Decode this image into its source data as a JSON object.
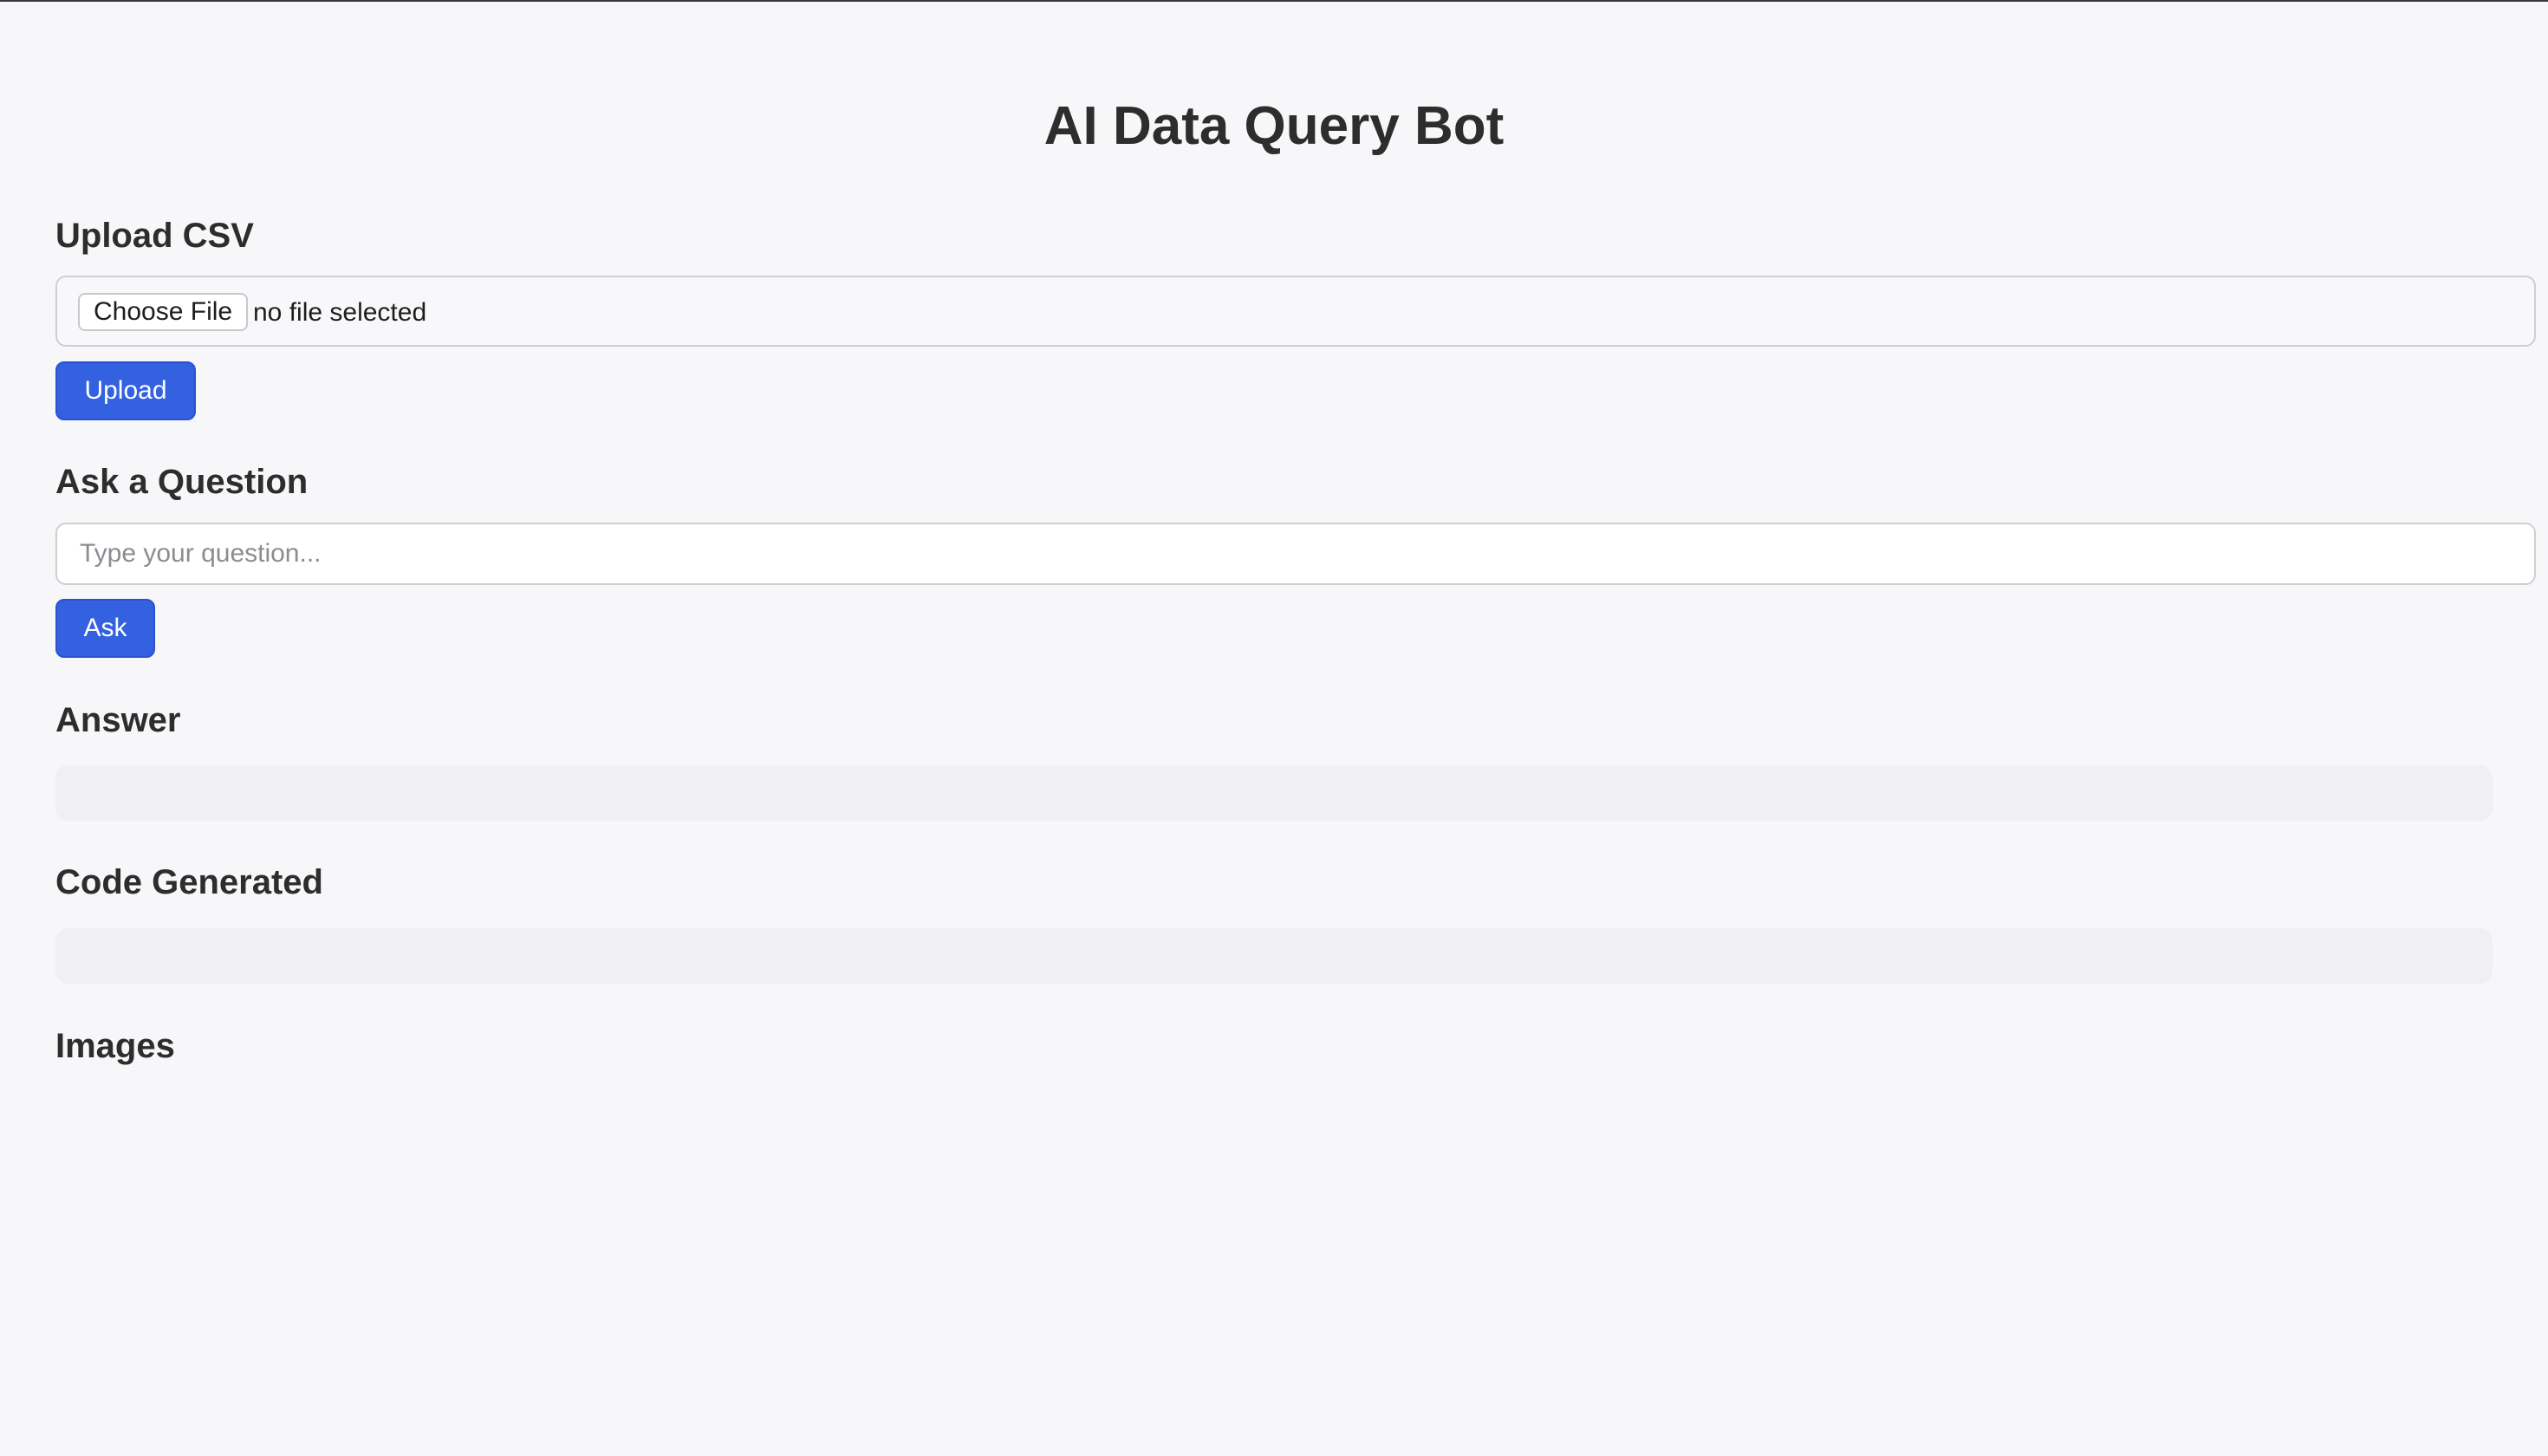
{
  "app": {
    "title": "AI Data Query Bot"
  },
  "upload": {
    "heading": "Upload CSV",
    "choose_file_label": "Choose File",
    "file_status": "no file selected",
    "upload_button": "Upload"
  },
  "ask": {
    "heading": "Ask a Question",
    "placeholder": "Type your question...",
    "value": "",
    "ask_button": "Ask"
  },
  "answer": {
    "heading": "Answer",
    "content": ""
  },
  "code": {
    "heading": "Code Generated",
    "content": ""
  },
  "images": {
    "heading": "Images"
  },
  "colors": {
    "background": "#f7f7f9",
    "accent": "#3461e0",
    "text": "#2d2d2d",
    "output_bg": "#f0f0f2"
  }
}
